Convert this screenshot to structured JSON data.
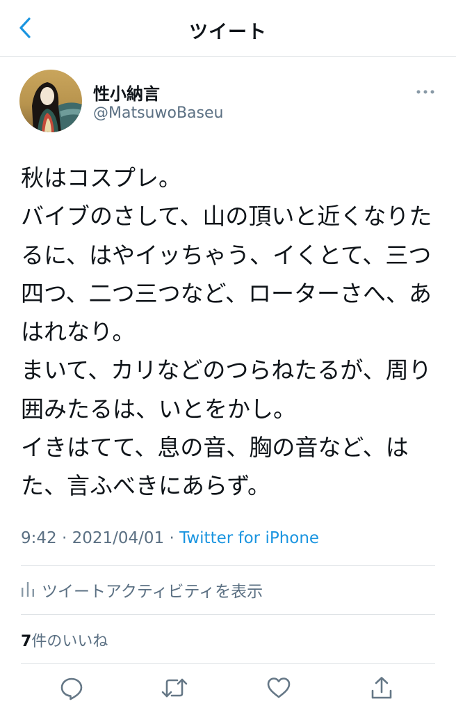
{
  "header": {
    "title": "ツイート",
    "back_icon": "chevron-left-icon"
  },
  "author": {
    "display_name": "性小納言",
    "handle": "@MatsuwoBaseu"
  },
  "tweet": {
    "text": "秋はコスプレ。\nバイブのさして、山の頂いと近くなりたるに、はやイッちゃう、イくとて、三つ四つ、二つ三つなど、ローターさへ、あはれなり。\nまいて、カリなどのつらねたるが、周り囲みたるは、いとをかし。\nイきはてて、息の音、胸の音など、はた、言ふべきにあらず。",
    "time": "9:42",
    "separator": "·",
    "date": "2021/04/01",
    "source": "Twitter for iPhone"
  },
  "activity": {
    "label": "ツイートアクティビティを表示",
    "icon": "bar-chart-icon"
  },
  "likes": {
    "count": "7",
    "label": "件のいいね"
  },
  "actions": [
    "reply-icon",
    "retweet-icon",
    "like-icon",
    "share-icon"
  ],
  "colors": {
    "accent": "#1b95e0",
    "secondary_text": "#5b7083",
    "icon_gray": "#657786",
    "divider": "#dfe3e6"
  }
}
